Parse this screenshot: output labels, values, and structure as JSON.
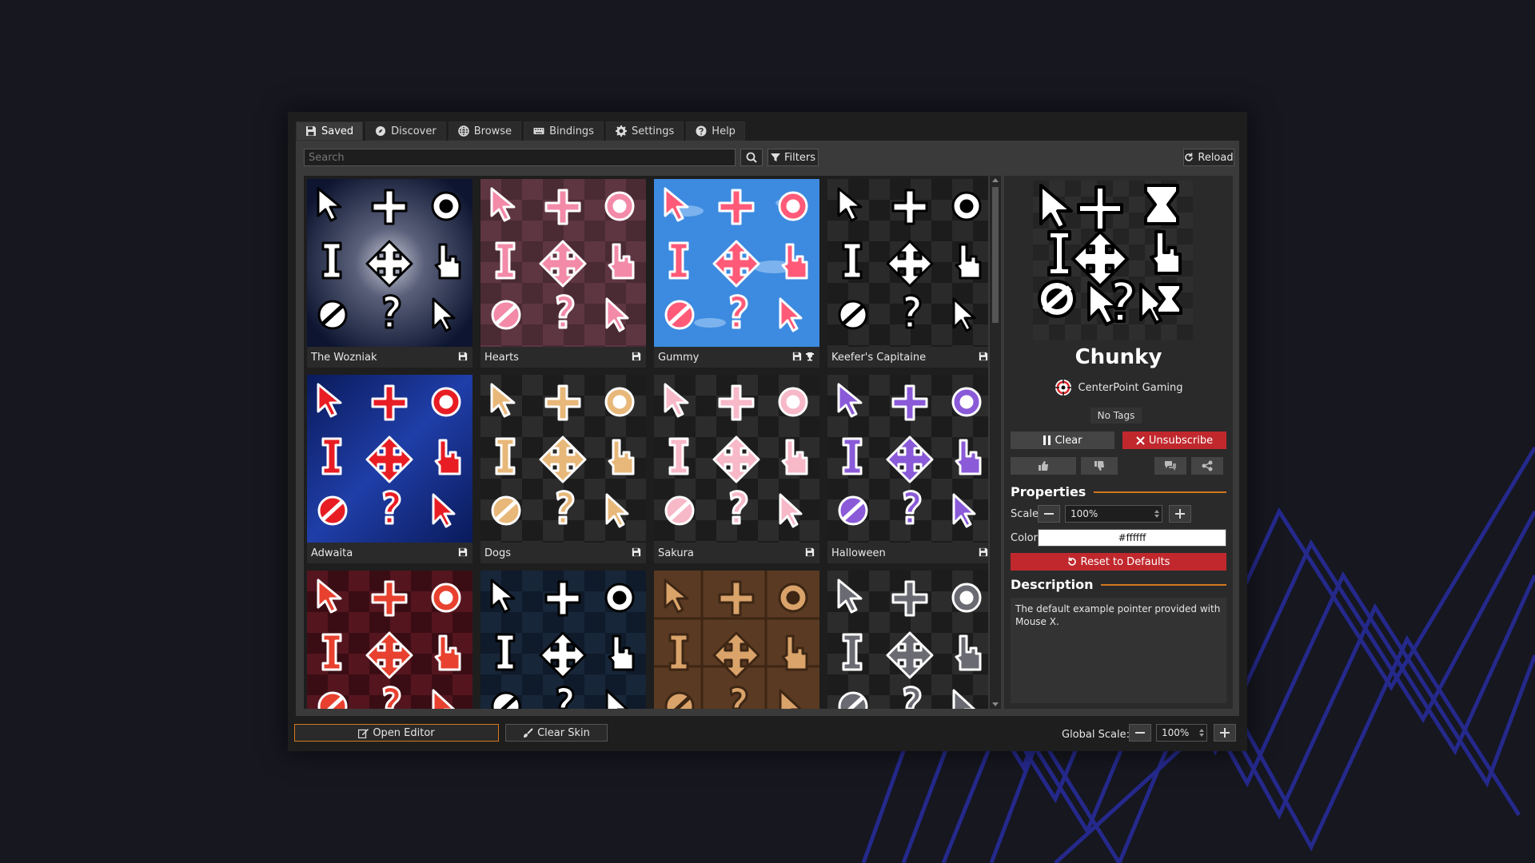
{
  "tabs": [
    {
      "label": "Saved",
      "icon": "save-icon"
    },
    {
      "label": "Discover",
      "icon": "compass-icon"
    },
    {
      "label": "Browse",
      "icon": "globe-icon"
    },
    {
      "label": "Bindings",
      "icon": "keyboard-icon"
    },
    {
      "label": "Settings",
      "icon": "gear-icon"
    },
    {
      "label": "Help",
      "icon": "help-icon"
    }
  ],
  "toolbar": {
    "search_placeholder": "Search",
    "filters_label": "Filters",
    "reload_label": "Reload"
  },
  "skins": [
    {
      "name": "The Wozniak",
      "theme": "galaxy"
    },
    {
      "name": "Hearts",
      "theme": "hearts"
    },
    {
      "name": "Gummy",
      "theme": "gummy",
      "trophy": true
    },
    {
      "name": "Keefer's Capitaine",
      "theme": "capitaine"
    },
    {
      "name": "Adwaita",
      "theme": "adwaita"
    },
    {
      "name": "Dogs",
      "theme": "dogs"
    },
    {
      "name": "Sakura",
      "theme": "sakura"
    },
    {
      "name": "Halloween",
      "theme": "halloween"
    },
    {
      "name": "",
      "theme": "fruits"
    },
    {
      "name": "",
      "theme": "dark"
    },
    {
      "name": "",
      "theme": "wood"
    },
    {
      "name": "",
      "theme": "cats"
    }
  ],
  "selected": {
    "title": "Chunky",
    "author": "CenterPoint Gaming",
    "tags": "No Tags",
    "clear_label": "Clear",
    "unsubscribe_label": "Unsubscribe"
  },
  "properties": {
    "heading": "Properties",
    "scale_label": "Scale",
    "scale_value": "100%",
    "color_label": "Color",
    "color_value": "#ffffff",
    "reset_label": "Reset to Defaults"
  },
  "description": {
    "heading": "Description",
    "text": "The default example pointer provided with Mouse X."
  },
  "bottom": {
    "open_editor_label": "Open Editor",
    "clear_skin_label": "Clear Skin",
    "global_scale_label": "Global Scale:",
    "global_scale_value": "100%"
  },
  "colors": {
    "accent": "#d4781e",
    "danger": "#c0282d"
  }
}
